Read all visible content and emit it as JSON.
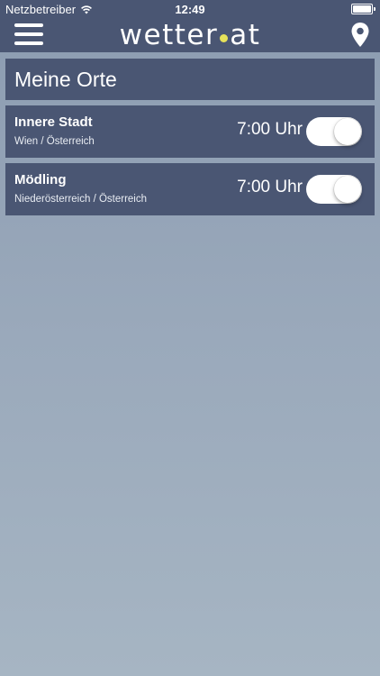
{
  "status_bar": {
    "carrier": "Netzbetreiber",
    "time": "12:49",
    "wifi_icon": "wifi-icon",
    "battery_icon": "battery-icon"
  },
  "nav": {
    "logo_left": "wetter",
    "logo_right": "at",
    "menu_icon": "hamburger-icon",
    "location_icon": "map-pin-icon"
  },
  "section": {
    "title": "Meine Orte"
  },
  "locations": [
    {
      "name": "Innere Stadt",
      "region": "Wien / Österreich",
      "time": "7:00 Uhr",
      "enabled": true
    },
    {
      "name": "Mödling",
      "region": "Niederösterreich / Österreich",
      "time": "7:00 Uhr",
      "enabled": true
    }
  ],
  "colors": {
    "bar": "#4a5673",
    "background": "#9aa9bb",
    "logo_dot": "#e6e25a"
  }
}
